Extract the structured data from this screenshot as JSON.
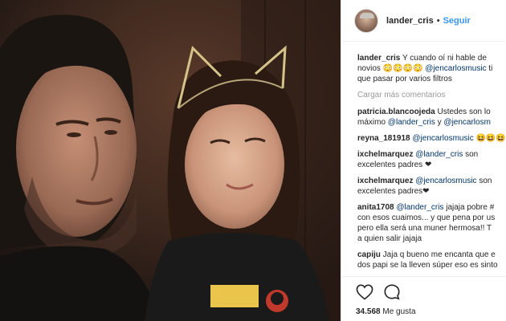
{
  "post": {
    "username": "lander_cris",
    "separator": "•",
    "follow_label": "Seguir"
  },
  "caption": {
    "user": "lander_cris",
    "line1": "Y cuando oí ni hable de",
    "line2_a": "novios 😳😳😳😳 ",
    "line2_mention": "@jencarlosmusic",
    "line2_b": " ti",
    "line3": "que pasar por varios filtros"
  },
  "load_more_label": "Cargar más comentarios",
  "comments": [
    {
      "user": "patricia.blancoojeda",
      "l1": " Ustedes son lo",
      "l2a": "máximo ",
      "l2m1": "@lander_cris",
      "l2b": " y ",
      "l2m2": "@jencarlosm"
    },
    {
      "user": "reyna_181918",
      "mention": " @jencarlosmusic",
      "tail": " 😆😆😆"
    },
    {
      "user": "ixchelmarquez",
      "mention": " @lander_cris",
      "tail": " son",
      "l2": "excelentes padres ❤"
    },
    {
      "user": "ixchelmarquez",
      "mention": " @jencarlosmusic",
      "tail": " son",
      "l2": "excelentes padres❤"
    },
    {
      "user": "anita1708",
      "mention": " @lander_cris",
      "tail": " jajaja pobre #",
      "l2": "con esos cuaimos... y que pena por us",
      "l3": "pero ella será una muner hermosa!! T",
      "l4": "a quien salir jajaja"
    },
    {
      "user": "capiju",
      "tail": " Jaja q bueno me encanta que e",
      "l2": "dos papi se la lleven súper eso es sinto"
    }
  ],
  "icons": [
    "heart-icon",
    "comment-icon"
  ],
  "likes": {
    "count": "34.568",
    "label": " Me gusta"
  }
}
